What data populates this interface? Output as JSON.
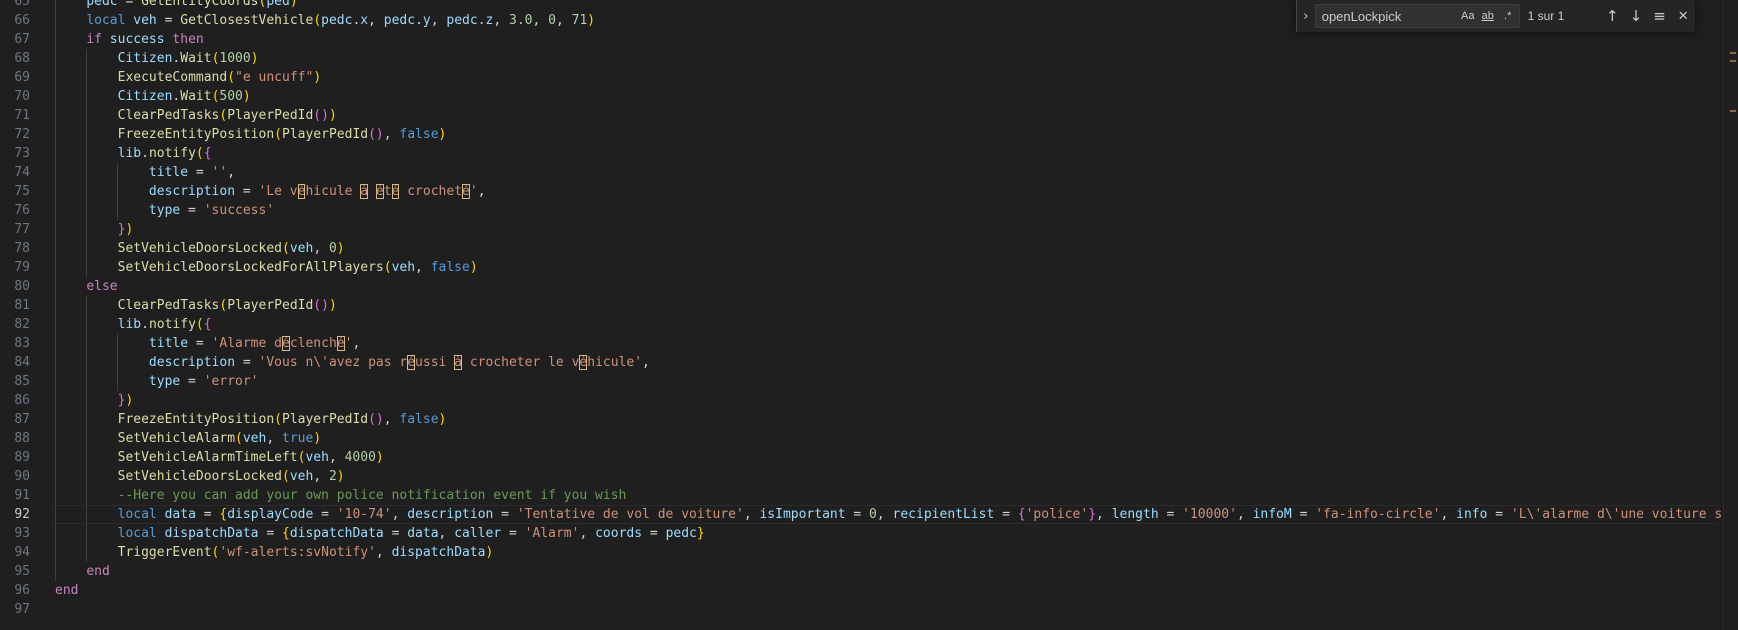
{
  "editor": {
    "current_line": 92,
    "indent_guide_color": "#404040",
    "lines": [
      {
        "n": "65",
        "indent": 1,
        "tokens": [
          [
            "var",
            "pedc"
          ],
          [
            "op",
            " = "
          ],
          [
            "fn",
            "GetEntityCoords"
          ],
          [
            "b1",
            "("
          ],
          [
            "var",
            "ped"
          ],
          [
            "b1",
            ")"
          ]
        ]
      },
      {
        "n": "66",
        "indent": 1,
        "tokens": [
          [
            "kw",
            "local"
          ],
          [
            "op",
            " "
          ],
          [
            "var",
            "veh"
          ],
          [
            "op",
            " = "
          ],
          [
            "fn",
            "GetClosestVehicle"
          ],
          [
            "b1",
            "("
          ],
          [
            "var",
            "pedc"
          ],
          [
            "op",
            "."
          ],
          [
            "var",
            "x"
          ],
          [
            "op",
            ", "
          ],
          [
            "var",
            "pedc"
          ],
          [
            "op",
            "."
          ],
          [
            "var",
            "y"
          ],
          [
            "op",
            ", "
          ],
          [
            "var",
            "pedc"
          ],
          [
            "op",
            "."
          ],
          [
            "var",
            "z"
          ],
          [
            "op",
            ", "
          ],
          [
            "num",
            "3.0"
          ],
          [
            "op",
            ", "
          ],
          [
            "num",
            "0"
          ],
          [
            "op",
            ", "
          ],
          [
            "num",
            "71"
          ],
          [
            "b1",
            ")"
          ]
        ]
      },
      {
        "n": "67",
        "indent": 1,
        "tokens": [
          [
            "ctl",
            "if"
          ],
          [
            "op",
            " "
          ],
          [
            "var",
            "success"
          ],
          [
            "op",
            " "
          ],
          [
            "ctl",
            "then"
          ]
        ]
      },
      {
        "n": "68",
        "indent": 2,
        "tokens": [
          [
            "var",
            "Citizen"
          ],
          [
            "op",
            "."
          ],
          [
            "fn",
            "Wait"
          ],
          [
            "b1",
            "("
          ],
          [
            "num",
            "1000"
          ],
          [
            "b1",
            ")"
          ]
        ]
      },
      {
        "n": "69",
        "indent": 2,
        "tokens": [
          [
            "fn",
            "ExecuteCommand"
          ],
          [
            "b1",
            "("
          ],
          [
            "str",
            "\"e uncuff\""
          ],
          [
            "b1",
            ")"
          ]
        ]
      },
      {
        "n": "70",
        "indent": 2,
        "tokens": [
          [
            "var",
            "Citizen"
          ],
          [
            "op",
            "."
          ],
          [
            "fn",
            "Wait"
          ],
          [
            "b1",
            "("
          ],
          [
            "num",
            "500"
          ],
          [
            "b1",
            ")"
          ]
        ]
      },
      {
        "n": "71",
        "indent": 2,
        "tokens": [
          [
            "fn",
            "ClearPedTasks"
          ],
          [
            "b1",
            "("
          ],
          [
            "fn",
            "PlayerPedId"
          ],
          [
            "b2",
            "()"
          ],
          [
            "b1",
            ")"
          ]
        ]
      },
      {
        "n": "72",
        "indent": 2,
        "tokens": [
          [
            "fn",
            "FreezeEntityPosition"
          ],
          [
            "b1",
            "("
          ],
          [
            "fn",
            "PlayerPedId"
          ],
          [
            "b2",
            "()"
          ],
          [
            "op",
            ", "
          ],
          [
            "bool",
            "false"
          ],
          [
            "b1",
            ")"
          ]
        ]
      },
      {
        "n": "73",
        "indent": 2,
        "tokens": [
          [
            "var",
            "lib"
          ],
          [
            "op",
            "."
          ],
          [
            "fn",
            "notify"
          ],
          [
            "b1",
            "("
          ],
          [
            "b2",
            "{"
          ]
        ]
      },
      {
        "n": "74",
        "indent": 3,
        "tokens": [
          [
            "var",
            "title"
          ],
          [
            "op",
            " = "
          ],
          [
            "str",
            "''"
          ],
          [
            "op",
            ","
          ]
        ]
      },
      {
        "n": "75",
        "indent": 3,
        "tokens": [
          [
            "var",
            "description"
          ],
          [
            "op",
            " = "
          ],
          [
            "str",
            "'Le v"
          ],
          [
            "hl",
            "é"
          ],
          [
            "str",
            "hicule "
          ],
          [
            "hl",
            "à"
          ],
          [
            "str",
            " "
          ],
          [
            "hl",
            "é"
          ],
          [
            "str",
            "t"
          ],
          [
            "hl",
            "é"
          ],
          [
            "str",
            " crochet"
          ],
          [
            "hl",
            "é"
          ],
          [
            "str",
            "'"
          ],
          [
            "op",
            ","
          ]
        ]
      },
      {
        "n": "76",
        "indent": 3,
        "tokens": [
          [
            "var",
            "type"
          ],
          [
            "op",
            " = "
          ],
          [
            "str",
            "'success'"
          ]
        ]
      },
      {
        "n": "77",
        "indent": 2,
        "tokens": [
          [
            "b2",
            "}"
          ],
          [
            "b1",
            ")"
          ]
        ]
      },
      {
        "n": "78",
        "indent": 2,
        "tokens": [
          [
            "fn",
            "SetVehicleDoorsLocked"
          ],
          [
            "b1",
            "("
          ],
          [
            "var",
            "veh"
          ],
          [
            "op",
            ", "
          ],
          [
            "num",
            "0"
          ],
          [
            "b1",
            ")"
          ]
        ]
      },
      {
        "n": "79",
        "indent": 2,
        "tokens": [
          [
            "fn",
            "SetVehicleDoorsLockedForAllPlayers"
          ],
          [
            "b1",
            "("
          ],
          [
            "var",
            "veh"
          ],
          [
            "op",
            ", "
          ],
          [
            "bool",
            "false"
          ],
          [
            "b1",
            ")"
          ]
        ]
      },
      {
        "n": "80",
        "indent": 1,
        "tokens": [
          [
            "ctl",
            "else"
          ]
        ]
      },
      {
        "n": "81",
        "indent": 2,
        "tokens": [
          [
            "fn",
            "ClearPedTasks"
          ],
          [
            "b1",
            "("
          ],
          [
            "fn",
            "PlayerPedId"
          ],
          [
            "b2",
            "()"
          ],
          [
            "b1",
            ")"
          ]
        ]
      },
      {
        "n": "82",
        "indent": 2,
        "tokens": [
          [
            "var",
            "lib"
          ],
          [
            "op",
            "."
          ],
          [
            "fn",
            "notify"
          ],
          [
            "b1",
            "("
          ],
          [
            "b2",
            "{"
          ]
        ]
      },
      {
        "n": "83",
        "indent": 3,
        "tokens": [
          [
            "var",
            "title"
          ],
          [
            "op",
            " = "
          ],
          [
            "str",
            "'Alarme d"
          ],
          [
            "hl",
            "é"
          ],
          [
            "str",
            "clench"
          ],
          [
            "hl",
            "é"
          ],
          [
            "str",
            "'"
          ],
          [
            "op",
            ","
          ]
        ]
      },
      {
        "n": "84",
        "indent": 3,
        "tokens": [
          [
            "var",
            "description"
          ],
          [
            "op",
            " = "
          ],
          [
            "str",
            "'Vous n\\'avez pas r"
          ],
          [
            "hl",
            "é"
          ],
          [
            "str",
            "ussi "
          ],
          [
            "hl",
            "à"
          ],
          [
            "str",
            " crocheter le v"
          ],
          [
            "hl",
            "é"
          ],
          [
            "str",
            "hicule'"
          ],
          [
            "op",
            ","
          ]
        ]
      },
      {
        "n": "85",
        "indent": 3,
        "tokens": [
          [
            "var",
            "type"
          ],
          [
            "op",
            " = "
          ],
          [
            "str",
            "'error'"
          ]
        ]
      },
      {
        "n": "86",
        "indent": 2,
        "tokens": [
          [
            "b2",
            "}"
          ],
          [
            "b1",
            ")"
          ]
        ]
      },
      {
        "n": "87",
        "indent": 2,
        "tokens": [
          [
            "fn",
            "FreezeEntityPosition"
          ],
          [
            "b1",
            "("
          ],
          [
            "fn",
            "PlayerPedId"
          ],
          [
            "b2",
            "()"
          ],
          [
            "op",
            ", "
          ],
          [
            "bool",
            "false"
          ],
          [
            "b1",
            ")"
          ]
        ]
      },
      {
        "n": "88",
        "indent": 2,
        "tokens": [
          [
            "fn",
            "SetVehicleAlarm"
          ],
          [
            "b1",
            "("
          ],
          [
            "var",
            "veh"
          ],
          [
            "op",
            ", "
          ],
          [
            "bool",
            "true"
          ],
          [
            "b1",
            ")"
          ]
        ]
      },
      {
        "n": "89",
        "indent": 2,
        "tokens": [
          [
            "fn",
            "SetVehicleAlarmTimeLeft"
          ],
          [
            "b1",
            "("
          ],
          [
            "var",
            "veh"
          ],
          [
            "op",
            ", "
          ],
          [
            "num",
            "4000"
          ],
          [
            "b1",
            ")"
          ]
        ]
      },
      {
        "n": "90",
        "indent": 2,
        "tokens": [
          [
            "fn",
            "SetVehicleDoorsLocked"
          ],
          [
            "b1",
            "("
          ],
          [
            "var",
            "veh"
          ],
          [
            "op",
            ", "
          ],
          [
            "num",
            "2"
          ],
          [
            "b1",
            ")"
          ]
        ]
      },
      {
        "n": "91",
        "indent": 2,
        "tokens": [
          [
            "cmt",
            "--Here you can add your own police notification event if you wish"
          ]
        ]
      },
      {
        "n": "92",
        "indent": 2,
        "tokens": [
          [
            "kw",
            "local"
          ],
          [
            "op",
            " "
          ],
          [
            "var",
            "data"
          ],
          [
            "op",
            " = "
          ],
          [
            "b1",
            "{"
          ],
          [
            "var",
            "displayCode"
          ],
          [
            "op",
            " = "
          ],
          [
            "str",
            "'10-74'"
          ],
          [
            "op",
            ", "
          ],
          [
            "var",
            "description"
          ],
          [
            "op",
            " = "
          ],
          [
            "str",
            "'Tentative de vol de voiture'"
          ],
          [
            "op",
            ", "
          ],
          [
            "var",
            "isImportant"
          ],
          [
            "op",
            " = "
          ],
          [
            "num",
            "0"
          ],
          [
            "op",
            ", "
          ],
          [
            "var",
            "recipientList"
          ],
          [
            "op",
            " = "
          ],
          [
            "b2",
            "{"
          ],
          [
            "str",
            "'police'"
          ],
          [
            "b2",
            "}"
          ],
          [
            "op",
            ", "
          ],
          [
            "var",
            "length"
          ],
          [
            "op",
            " = "
          ],
          [
            "str",
            "'10000'"
          ],
          [
            "op",
            ", "
          ],
          [
            "var",
            "infoM"
          ],
          [
            "op",
            " = "
          ],
          [
            "str",
            "'fa-info-circle'"
          ],
          [
            "op",
            ", "
          ],
          [
            "var",
            "info"
          ],
          [
            "op",
            " = "
          ],
          [
            "str",
            "'L\\'alarme d\\'une voiture s\\'es"
          ]
        ]
      },
      {
        "n": "93",
        "indent": 2,
        "tokens": [
          [
            "kw",
            "local"
          ],
          [
            "op",
            " "
          ],
          [
            "var",
            "dispatchData"
          ],
          [
            "op",
            " = "
          ],
          [
            "b1",
            "{"
          ],
          [
            "var",
            "dispatchData"
          ],
          [
            "op",
            " = "
          ],
          [
            "var",
            "data"
          ],
          [
            "op",
            ", "
          ],
          [
            "var",
            "caller"
          ],
          [
            "op",
            " = "
          ],
          [
            "str",
            "'Alarm'"
          ],
          [
            "op",
            ", "
          ],
          [
            "var",
            "coords"
          ],
          [
            "op",
            " = "
          ],
          [
            "var",
            "pedc"
          ],
          [
            "b1",
            "}"
          ]
        ]
      },
      {
        "n": "94",
        "indent": 2,
        "tokens": [
          [
            "fn",
            "TriggerEvent"
          ],
          [
            "b1",
            "("
          ],
          [
            "str",
            "'wf-alerts:svNotify'"
          ],
          [
            "op",
            ", "
          ],
          [
            "var",
            "dispatchData"
          ],
          [
            "b1",
            ")"
          ]
        ]
      },
      {
        "n": "95",
        "indent": 1,
        "tokens": [
          [
            "ctl",
            "end"
          ]
        ]
      },
      {
        "n": "96",
        "indent": 0,
        "tokens": [
          [
            "ctl",
            "end"
          ]
        ]
      },
      {
        "n": "97",
        "indent": 0,
        "tokens": []
      }
    ]
  },
  "find": {
    "toggle_icon": "›",
    "query": "openLockpick",
    "match_case_label": "Aa",
    "whole_word_label": "ab",
    "regex_label": ".*",
    "match_count": "1 sur 1",
    "prev_icon": "↑",
    "next_icon": "↓",
    "selection_icon": "≡",
    "close_icon": "✕"
  }
}
